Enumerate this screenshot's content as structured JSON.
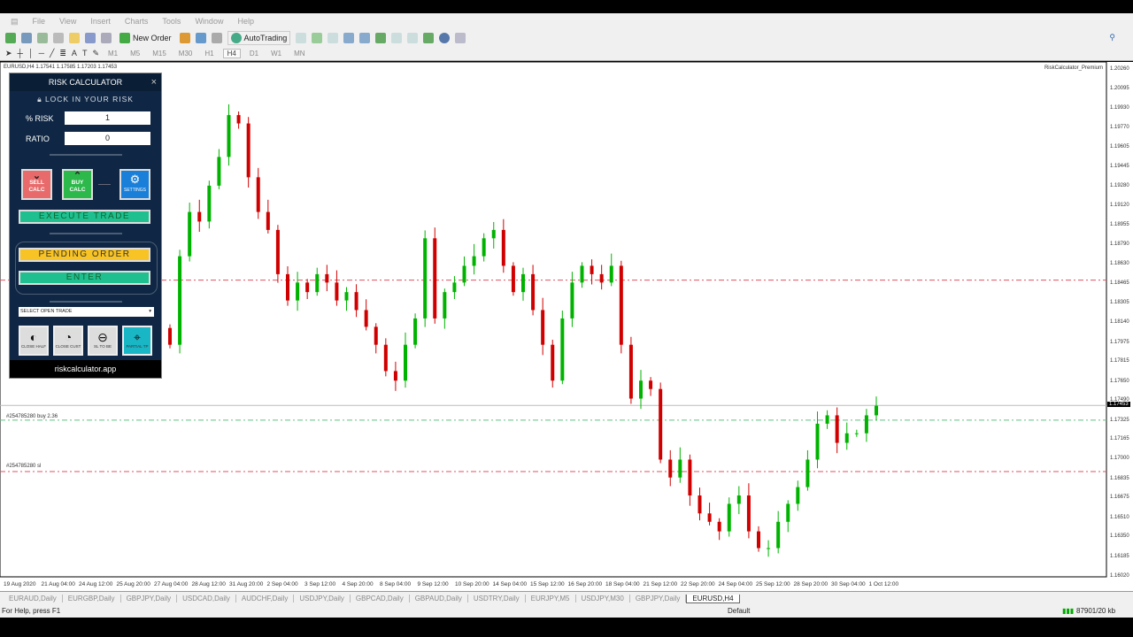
{
  "menu": [
    "File",
    "View",
    "Insert",
    "Charts",
    "Tools",
    "Window",
    "Help"
  ],
  "toolbar": {
    "new_order": "New Order",
    "autotrading": "AutoTrading",
    "timeframes": [
      "M1",
      "M5",
      "M15",
      "M30",
      "H1",
      "H4",
      "D1",
      "W1",
      "MN"
    ],
    "active_timeframe": "H4"
  },
  "chart": {
    "symbol_info": "EURUSD,H4  1.17541 1.17585 1.17203 1.17453",
    "indicator_label": "RiskCalculator_Premium",
    "price_ticks": [
      "1.20260",
      "1.20095",
      "1.19930",
      "1.19770",
      "1.19605",
      "1.19445",
      "1.19280",
      "1.19120",
      "1.18955",
      "1.18790",
      "1.18630",
      "1.18465",
      "1.18305",
      "1.18140",
      "1.17975",
      "1.17815",
      "1.17650",
      "1.17490",
      "1.17325",
      "1.17165",
      "1.17000",
      "1.16835",
      "1.16675",
      "1.16510",
      "1.16350",
      "1.16185",
      "1.16020"
    ],
    "current_price": "1.17453",
    "time_ticks": [
      "19 Aug 2020",
      "21 Aug 04:00",
      "24 Aug 12:00",
      "25 Aug 20:00",
      "27 Aug 04:00",
      "28 Aug 12:00",
      "31 Aug 20:00",
      "2 Sep 04:00",
      "3 Sep 12:00",
      "4 Sep 20:00",
      "8 Sep 04:00",
      "9 Sep 12:00",
      "10 Sep 20:00",
      "14 Sep 04:00",
      "15 Sep 12:00",
      "16 Sep 20:00",
      "18 Sep 04:00",
      "21 Sep 12:00",
      "22 Sep 20:00",
      "24 Sep 04:00",
      "25 Sep 12:00",
      "28 Sep 20:00",
      "30 Sep 04:00",
      "1 Oct 12:00"
    ],
    "order_labels": {
      "buy": "#254785280 buy 2.36",
      "sl": "#254785280 sl"
    },
    "levels": {
      "pending_red": 1.185,
      "tp_green": 1.1733,
      "sl_red": 1.169,
      "current": 1.17453
    },
    "colors": {
      "bull": "#00b300",
      "bear": "#d00000",
      "red_line": "#e05060",
      "green_line": "#60c080"
    },
    "first_open": 1.181,
    "closes": [
      1.1796,
      1.187,
      1.1907,
      1.1899,
      1.1929,
      1.1953,
      1.1988,
      1.1981,
      1.1936,
      1.1907,
      1.1892,
      1.1855,
      1.1833,
      1.1848,
      1.184,
      1.1855,
      1.1848,
      1.1833,
      1.184,
      1.1825,
      1.1811,
      1.1796,
      1.1774,
      1.1766,
      1.1796,
      1.1818,
      1.1885,
      1.1818,
      1.184,
      1.1848,
      1.1862,
      1.187,
      1.1885,
      1.1892,
      1.1862,
      1.184,
      1.1855,
      1.1825,
      1.1796,
      1.1766,
      1.1818,
      1.1848,
      1.1862,
      1.1855,
      1.1848,
      1.1862,
      1.1796,
      1.1751,
      1.1766,
      1.1759,
      1.17,
      1.1685,
      1.17,
      1.167,
      1.1655,
      1.1648,
      1.164,
      1.1663,
      1.167,
      1.164,
      1.1626,
      1.1626,
      1.1648,
      1.1663,
      1.1677,
      1.17,
      1.173,
      1.1737,
      1.1714,
      1.1722,
      1.1722,
      1.1737,
      1.1745
    ]
  },
  "panel": {
    "title": "RISK CALCULATOR",
    "lock": "LOCK IN YOUR RISK",
    "risk_label": "% RISK",
    "risk_value": "1",
    "ratio_label": "RATIO",
    "ratio_value": "0",
    "sell": "SELL CALC",
    "buy": "BUY CALC",
    "settings": "SETTINGS",
    "execute": "EXECUTE TRADE",
    "pending": "PENDING ORDER",
    "enter": "ENTER",
    "select_trade": "SELECT OPEN TRADE",
    "close_half": "CLOSE HALF",
    "close_cust": "CLOSE CUST",
    "sl_to_be": "SL TO BE",
    "partial_tp": "PARTIAL TP",
    "footer": "riskcalculator.app"
  },
  "tabs": [
    "EURAUD,Daily",
    "EURGBP,Daily",
    "GBPJPY,Daily",
    "USDCAD,Daily",
    "AUDCHF,Daily",
    "USDJPY,Daily",
    "GBPCAD,Daily",
    "GBPAUD,Daily",
    "USDTRY,Daily",
    "EURJPY,M5",
    "USDJPY,M30",
    "GBPJPY,Daily",
    "EURUSD,H4"
  ],
  "status": {
    "help": "For Help, press F1",
    "profile": "Default",
    "traffic": "87901/20 kb"
  }
}
